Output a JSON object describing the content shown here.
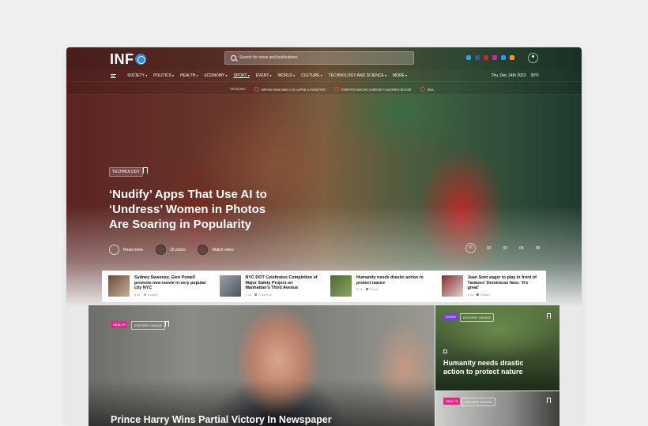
{
  "header": {
    "logo": "INF",
    "search_placeholder": "Search for news and publications",
    "date": "Thu, Dec 14th 2023",
    "weather": "30°F"
  },
  "nav": {
    "items": [
      "SOCIETY",
      "POLITICS",
      "HEALTH",
      "ECONOMY",
      "SPORT",
      "EVENT",
      "WORLD",
      "CULTURE",
      "TECHNOLOGY AND SCIENCE",
      "MORE"
    ],
    "active": "SPORT"
  },
  "trending": {
    "label": "TRENDING",
    "items": [
      "BRONX BUILDING COLLAPSE A DISASTER",
      "DORITOS NACHO CHEESE FLAVORED BOOZE",
      "SEA"
    ]
  },
  "hero": {
    "tag": "TECHNOLOGY",
    "headline": "‘Nudify’ Apps That Use AI to ‘Undress’ Women in Photos Are Soaring in Popularity",
    "actions": {
      "read": "Read news",
      "photo": "16 photo",
      "video": "Watch video"
    },
    "slides": [
      "01",
      "02",
      "03",
      "04",
      "05"
    ]
  },
  "strip": [
    {
      "title": "Sydney Sweeney, Glen Powell promote new movie in very popular city NYC",
      "meta": "3.8k",
      "cat": "Society",
      "color": "#c7a36a"
    },
    {
      "title": "NYC DOT Celebrates Completion of Major Safety Project on Manhattan’s Third Avenue",
      "meta": "1.4k",
      "cat": "Economy",
      "color": "#7a8a99"
    },
    {
      "title": "Humanity needs drastic action to protect nature",
      "meta": "2.4k",
      "cat": "World",
      "color": "#5c7a3f"
    },
    {
      "title": "Juan Soto eager to play in front of Yankees’ Dominican fans: ‘It’s great’",
      "meta": "1.2k",
      "cat": "Health",
      "color": "#a84a4a"
    }
  ],
  "feature": {
    "tag1": "HEALTH",
    "tag2": "EDITORS' CHOICE",
    "title": "Prince Harry Wins Partial Victory In Newspaper"
  },
  "side1": {
    "tag1": "EVENT",
    "tag2": "EDITORS' CHOICE",
    "title": "Humanity needs drastic action to protect nature"
  },
  "side2": {
    "tag1": "HEALTH",
    "tag2": "EDITORS' CHOICE"
  }
}
